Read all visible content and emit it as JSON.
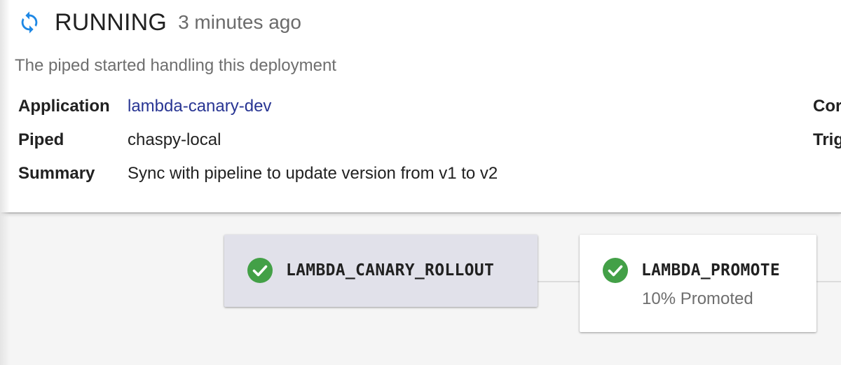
{
  "header": {
    "status": "RUNNING",
    "time_ago": "3 minutes ago",
    "status_icon": "sync-icon",
    "status_color": "#1e88e5",
    "description": "The piped started handling this deployment"
  },
  "info": {
    "application_label": "Application",
    "application_value": "lambda-canary-dev",
    "piped_label": "Piped",
    "piped_value": "chaspy-local",
    "summary_label": "Summary",
    "summary_value": "Sync with pipeline to update version from v1 to v2",
    "right_label_1": "Cor",
    "right_label_2": "Trig"
  },
  "pipeline": {
    "check_color": "#43a047",
    "stages": [
      {
        "name": "LAMBDA_CANARY_ROLLOUT",
        "description": "",
        "status_icon": "check-circle-icon",
        "active": true
      },
      {
        "name": "LAMBDA_PROMOTE",
        "description": "10% Promoted",
        "status_icon": "check-circle-icon",
        "active": false
      }
    ]
  }
}
